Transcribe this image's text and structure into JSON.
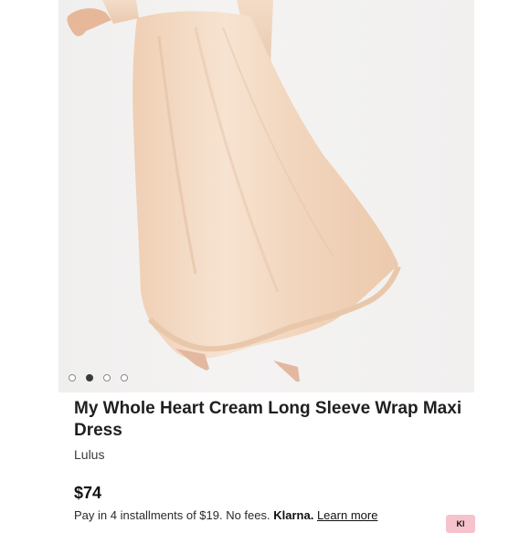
{
  "product": {
    "title": "My Whole Heart Cream Long Sleeve Wrap Maxi Dress",
    "brand": "Lulus",
    "price": "$74"
  },
  "carousel": {
    "total": 4,
    "active_index": 1
  },
  "payment": {
    "text": "Pay in 4 installments of $19. No fees.",
    "provider": "Klarna.",
    "learn_more": "Learn more",
    "badge": "Kl"
  },
  "colors": {
    "dress": "#f4dcc6",
    "background": "#f2f1f0",
    "klarna_pink": "#f6c2cc"
  }
}
